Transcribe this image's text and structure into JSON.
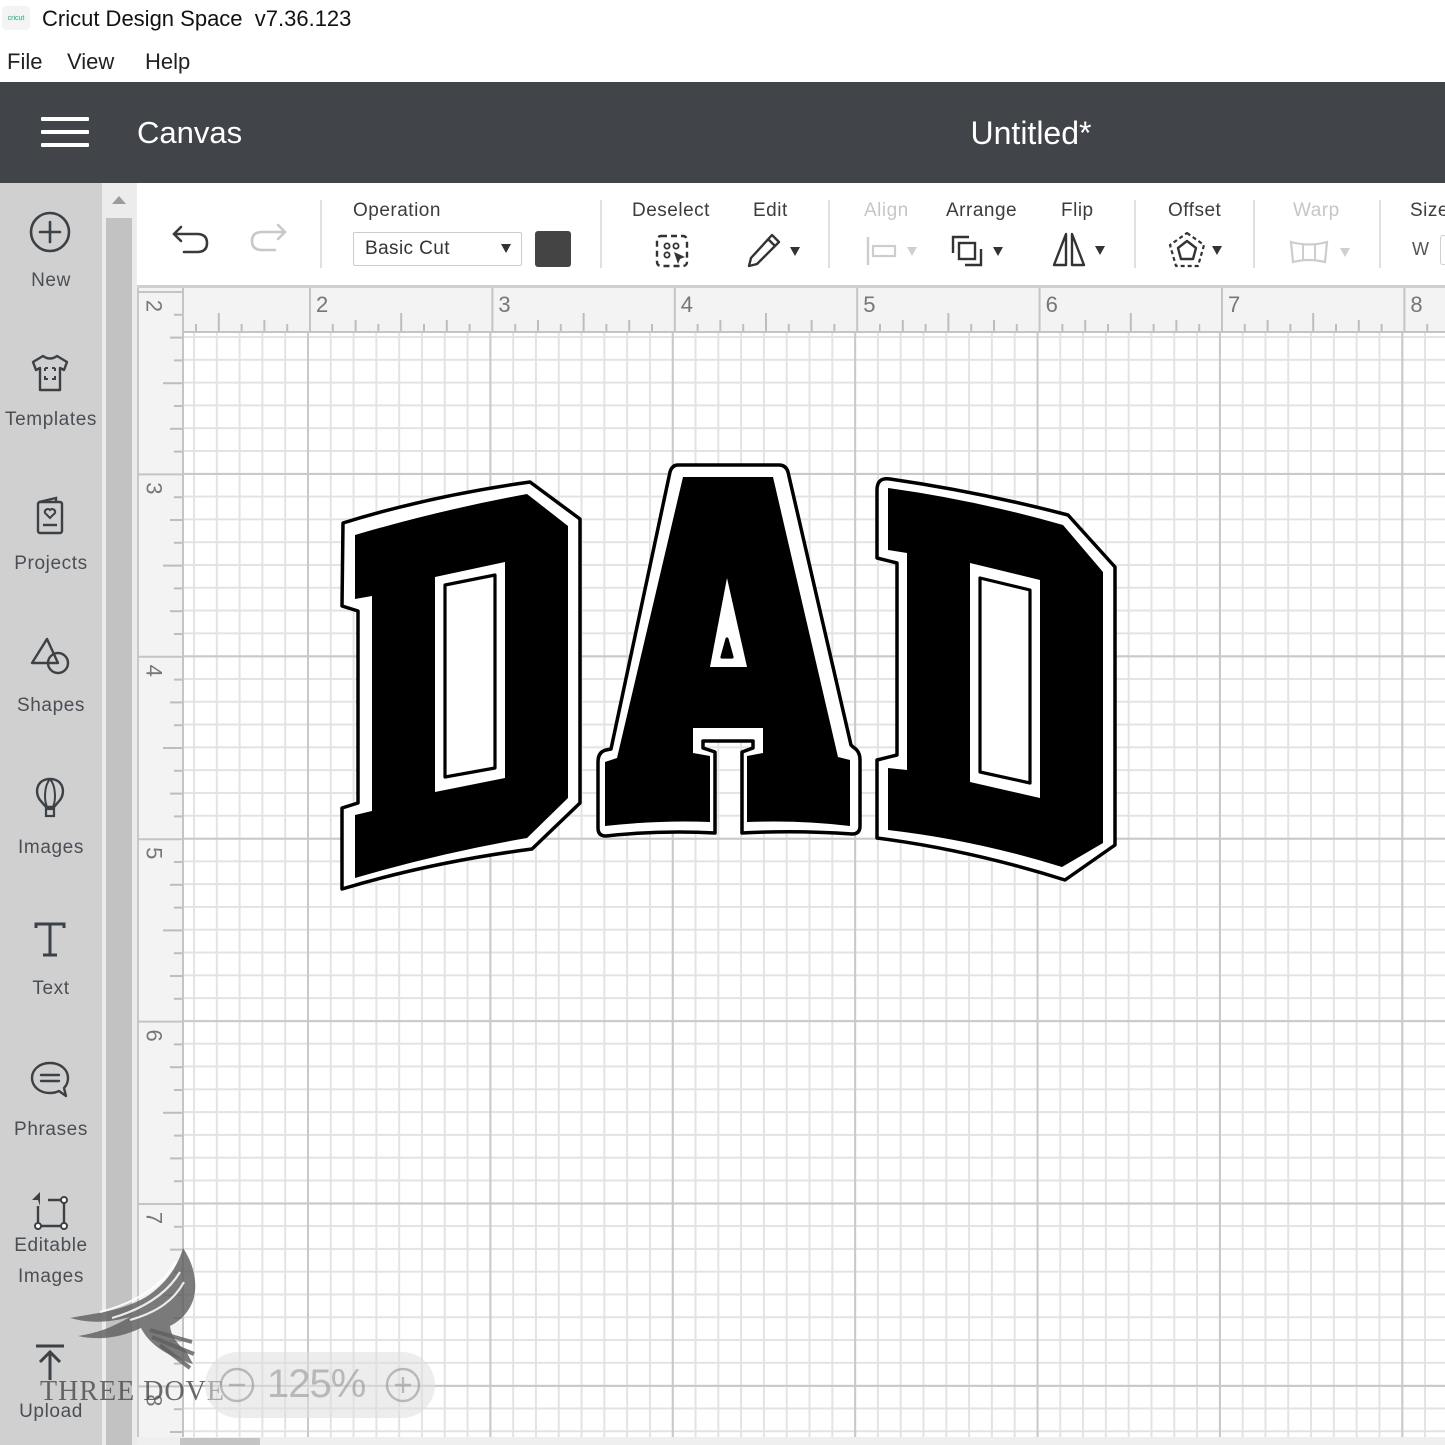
{
  "window": {
    "app_icon_text": "cricut",
    "title": "Cricut Design Space  v7.36.123"
  },
  "menu": [
    {
      "label": "File"
    },
    {
      "label": "View"
    },
    {
      "label": "Help"
    }
  ],
  "header": {
    "menu_icon": "hamburger-icon",
    "section": "Canvas",
    "project_title": "Untitled*"
  },
  "sidebar": {
    "items": [
      {
        "label": "New",
        "icon": "plus-circle-icon"
      },
      {
        "label": "Templates",
        "icon": "tshirt-icon"
      },
      {
        "label": "Projects",
        "icon": "project-card-icon"
      },
      {
        "label": "Shapes",
        "icon": "shapes-icon"
      },
      {
        "label": "Images",
        "icon": "balloon-icon"
      },
      {
        "label": "Text",
        "icon": "text-icon"
      },
      {
        "label": "Phrases",
        "icon": "speech-bubble-icon"
      },
      {
        "label": "Editable Images",
        "icon": "editable-image-icon"
      },
      {
        "label": "Upload",
        "icon": "upload-icon"
      }
    ]
  },
  "toolbar": {
    "undo": {
      "icon": "undo-icon",
      "enabled": true
    },
    "redo": {
      "icon": "redo-icon",
      "enabled": false
    },
    "operation": {
      "label": "Operation",
      "value": "Basic Cut",
      "color": "#444444"
    },
    "deselect": {
      "label": "Deselect",
      "enabled": true
    },
    "edit": {
      "label": "Edit",
      "enabled": true
    },
    "align": {
      "label": "Align",
      "enabled": false
    },
    "arrange": {
      "label": "Arrange",
      "enabled": true
    },
    "flip": {
      "label": "Flip",
      "enabled": true
    },
    "offset": {
      "label": "Offset",
      "enabled": true
    },
    "warp": {
      "label": "Warp",
      "enabled": false
    },
    "size": {
      "label": "Size",
      "w_label": "W"
    }
  },
  "ruler": {
    "units": "in",
    "top_labels": [
      "2",
      "3",
      "4",
      "5",
      "6",
      "7",
      "8"
    ],
    "left_labels": [
      "2",
      "3",
      "4",
      "5",
      "6",
      "7",
      "8"
    ]
  },
  "canvas": {
    "design": {
      "text": "DAD",
      "fill": "#000000",
      "outline": "#000000",
      "style": "arched varsity letters with offset outline"
    }
  },
  "zoom": {
    "level": "125%"
  },
  "watermark": {
    "text": "THREE DOVE"
  },
  "colors": {
    "header_bg": "#414449",
    "sidebar_bg": "#d0d0d0",
    "swatch": "#444444"
  }
}
